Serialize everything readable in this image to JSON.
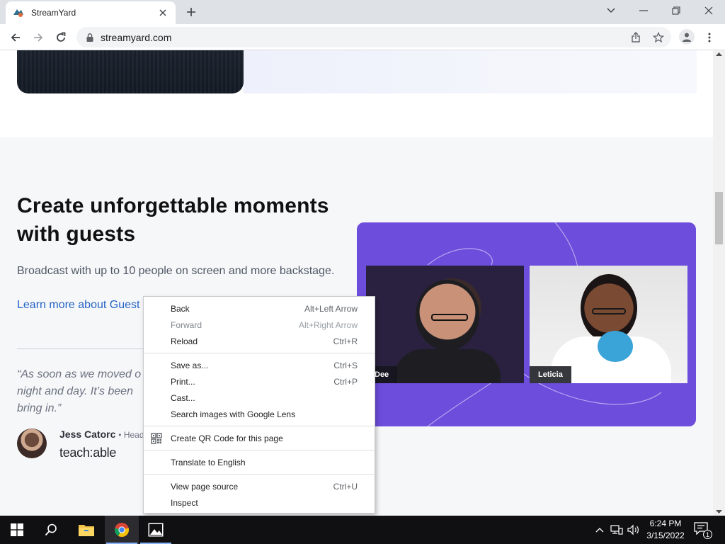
{
  "browser": {
    "tab_title": "StreamYard",
    "url": "streamyard.com",
    "favicon": "streamyard-icon"
  },
  "page": {
    "headline_line1": "Create unforgettable moments",
    "headline_line2": "with guests",
    "subtext": "Broadcast with up to 10 people on screen and more backstage.",
    "learn_more_link": "Learn more about Guest",
    "quote_line1": "“As soon as we moved o",
    "quote_line2": "night and day. It’s been",
    "quote_line3": "bring in.”",
    "person_name": "Jess Catorc",
    "person_role": "• Head",
    "company": "teach:able",
    "video_left_label": "Dee",
    "video_right_label": "Leticia",
    "accent_purple": "#6c4ddc"
  },
  "context_menu": {
    "back": {
      "label": "Back",
      "accel": "Alt+Left Arrow"
    },
    "forward": {
      "label": "Forward",
      "accel": "Alt+Right Arrow"
    },
    "reload": {
      "label": "Reload",
      "accel": "Ctrl+R"
    },
    "save_as": {
      "label": "Save as...",
      "accel": "Ctrl+S"
    },
    "print": {
      "label": "Print...",
      "accel": "Ctrl+P"
    },
    "cast": {
      "label": "Cast..."
    },
    "search_lens": {
      "label": "Search images with Google Lens"
    },
    "qr_code": {
      "label": "Create QR Code for this page",
      "icon": "qr-code-icon"
    },
    "translate": {
      "label": "Translate to English"
    },
    "view_source": {
      "label": "View page source",
      "accel": "Ctrl+U"
    },
    "inspect": {
      "label": "Inspect"
    }
  },
  "taskbar": {
    "time": "6:24 PM",
    "date": "3/15/2022",
    "notification_count": "1",
    "apps": [
      "windows-start-icon",
      "search-icon",
      "file-explorer-icon",
      "chrome-icon",
      "photos-icon"
    ]
  }
}
